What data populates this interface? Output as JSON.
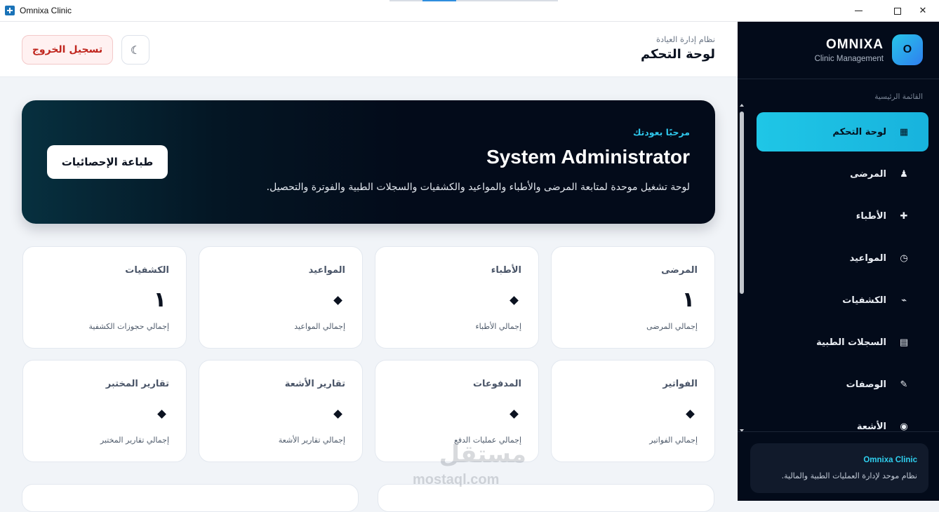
{
  "window": {
    "title": "Omnixa Clinic",
    "minimize": "",
    "maximize": "",
    "close": "✕"
  },
  "sidebar": {
    "logo_letter": "O",
    "brand_name": "OMNIXA",
    "brand_sub": "Clinic Management",
    "section_label": "القائمة الرئيسية",
    "items": [
      {
        "label": "لوحة التحكم",
        "icon": "grid-icon",
        "glyph": "▦",
        "active": true
      },
      {
        "label": "المرضى",
        "icon": "patient-icon",
        "glyph": "♟",
        "active": false
      },
      {
        "label": "الأطباء",
        "icon": "plus-icon",
        "glyph": "✚",
        "active": false
      },
      {
        "label": "المواعيد",
        "icon": "clock-icon",
        "glyph": "◷",
        "active": false
      },
      {
        "label": "الكشفيات",
        "icon": "stethoscope-icon",
        "glyph": "⌁",
        "active": false
      },
      {
        "label": "السجلات الطبية",
        "icon": "records-icon",
        "glyph": "▤",
        "active": false
      },
      {
        "label": "الوصفات",
        "icon": "pen-icon",
        "glyph": "✎",
        "active": false
      },
      {
        "label": "الأشعة",
        "icon": "radiology-icon",
        "glyph": "◉",
        "active": false
      }
    ],
    "footer_title": "Omnixa Clinic",
    "footer_desc": "نظام موحد لإدارة العمليات الطبية والمالية."
  },
  "header": {
    "subtitle": "نظام إدارة العيادة",
    "title": "لوحة التحكم",
    "logout_label": "تسجيل الخروج",
    "theme_glyph": "☾"
  },
  "banner": {
    "welcome": "مرحبًا بعودتك",
    "name": "System Administrator",
    "description": "لوحة تشغيل موحدة لمتابعة المرضى والأطباء والمواعيد والكشفيات والسجلات الطبية والفوترة والتحصيل.",
    "print_label": "طباعة الإحصائيات"
  },
  "stats": [
    {
      "title": "المرضى",
      "value": "١",
      "desc": "إجمالي المرضى"
    },
    {
      "title": "الأطباء",
      "value": "",
      "desc": "إجمالي الأطباء"
    },
    {
      "title": "المواعيد",
      "value": "",
      "desc": "إجمالي المواعيد"
    },
    {
      "title": "الكشفيات",
      "value": "١",
      "desc": "إجمالي حجوزات الكشفية"
    },
    {
      "title": "الفواتير",
      "value": "",
      "desc": "إجمالي الفواتير"
    },
    {
      "title": "المدفوعات",
      "value": "",
      "desc": "إجمالي عمليات الدفع"
    },
    {
      "title": "تقارير الأشعة",
      "value": "",
      "desc": "إجمالي تقارير الأشعة"
    },
    {
      "title": "تقارير المختبر",
      "value": "",
      "desc": "إجمالي تقارير المختبر"
    }
  ],
  "watermark": {
    "arabic": "مستقل",
    "latin": "mostaql.com"
  }
}
